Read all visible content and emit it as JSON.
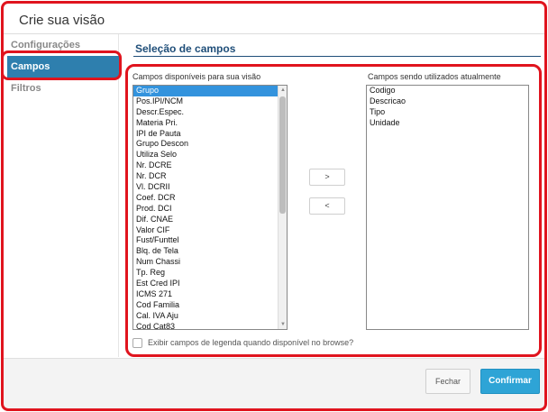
{
  "dialog": {
    "title": "Crie sua visão"
  },
  "sidebar": {
    "items": [
      {
        "label": "Configurações"
      },
      {
        "label": "Campos"
      },
      {
        "label": "Filtros"
      }
    ],
    "selected": "Campos"
  },
  "section": {
    "title": "Seleção de campos"
  },
  "available": {
    "label": "Campos disponíveis para sua visão",
    "items": [
      "Grupo",
      "Pos.IPI/NCM",
      "Descr.Espec.",
      "Materia Pri.",
      "IPI de Pauta",
      "Grupo Descon",
      "Utiliza Selo",
      "Nr. DCRE",
      "Nr. DCR",
      "Vl. DCRII",
      "Coef. DCR",
      "Prod. DCI",
      "Dif. CNAE",
      "Valor CIF",
      "Fust/Funttel",
      "Blq. de Tela",
      "Num Chassi",
      "Tp. Reg",
      "Est Cred IPI",
      "ICMS 271",
      "Cod Familia",
      "Cal. IVA Aju",
      "Cod Cat83"
    ],
    "selected": "Grupo"
  },
  "used": {
    "label": "Campos sendo utilizados atualmente",
    "items": [
      "Codigo",
      "Descricao",
      "Tipo",
      "Unidade"
    ]
  },
  "move": {
    "add": ">",
    "remove": "<"
  },
  "legend_checkbox": {
    "label": "Exibir campos de legenda quando disponível no browse?",
    "checked": false
  },
  "footer": {
    "close_label": "Fechar",
    "confirm_label": "Confirmar"
  },
  "colors": {
    "highlight": "#e0141e",
    "selected_nav": "#2e7fae",
    "section_title": "#1f4e79",
    "list_selection": "#3393dd",
    "confirm_button": "#2ea4d6"
  }
}
